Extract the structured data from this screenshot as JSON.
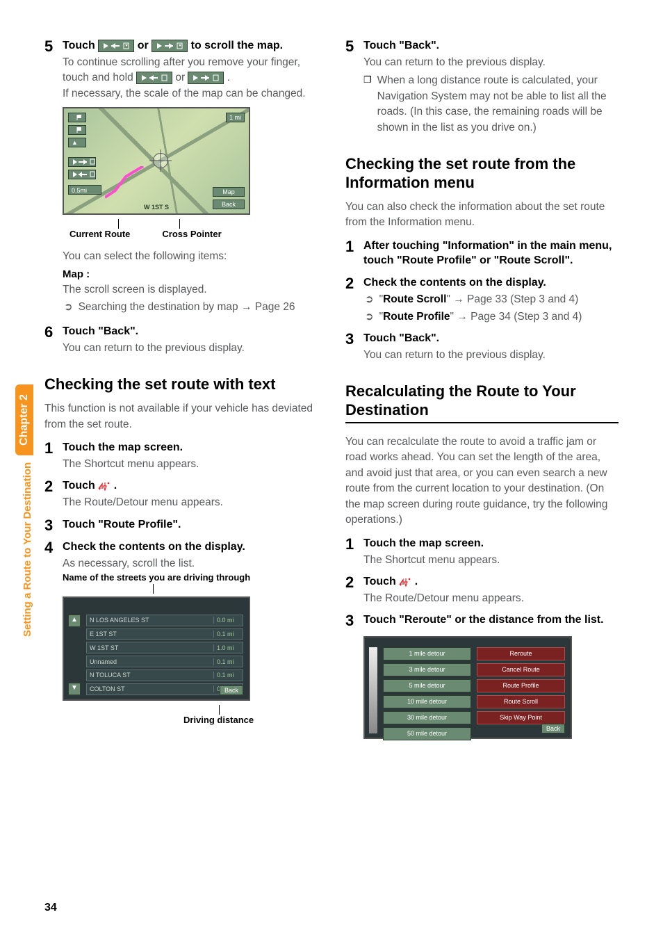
{
  "side": {
    "section": "Setting a Route to Your Destination",
    "chapter": "Chapter 2"
  },
  "page_number": "34",
  "left": {
    "step5": {
      "num": "5",
      "title_a": "Touch ",
      "title_b": " or ",
      "title_c": " to scroll the map.",
      "text_a": "To continue scrolling after you remove your finger, touch and hold ",
      "text_b": " or ",
      "text_c": ".",
      "text_d": "If necessary, the scale of the map can be changed.",
      "img_label_left": "Current Route",
      "img_label_right": "Cross Pointer",
      "text_e": "You can select the following items:",
      "map_label": "Map :",
      "map_text": "The scroll screen is displayed.",
      "sub_bullet": "Searching the destination by map ",
      "sub_bullet_ref": "Page 26",
      "map_ui": {
        "scale_btn": "1 mi",
        "map_btn": "Map",
        "back_btn": "Back",
        "dist_btn": "0.5mi",
        "street": "W 1ST S"
      }
    },
    "step6": {
      "num": "6",
      "title": "Touch \"Back\".",
      "text": "You can return to the previous display."
    },
    "h2a": "Checking the set route with text",
    "h2a_text": "This function is not available if your vehicle has deviated from the set route.",
    "text_step1": {
      "num": "1",
      "title": "Touch the map screen.",
      "text": "The Shortcut menu appears."
    },
    "text_step2": {
      "num": "2",
      "title_a": "Touch ",
      "title_b": ".",
      "text": "The Route/Detour menu appears."
    },
    "text_step3": {
      "num": "3",
      "title": "Touch \"Route Profile\"."
    },
    "text_step4": {
      "num": "4",
      "title": "Check the contents on the display.",
      "text": "As necessary, scroll the list."
    },
    "profile_caption_top": "Name of the streets you are driving through",
    "profile_rows": [
      {
        "name": "N LOS ANGELES ST",
        "dist": "0.0  mi"
      },
      {
        "name": "E 1ST ST",
        "dist": "0.1  mi"
      },
      {
        "name": "W 1ST ST",
        "dist": "1.0  mi"
      },
      {
        "name": "Unnamed",
        "dist": "0.1  mi"
      },
      {
        "name": "N TOLUCA ST",
        "dist": "0.1  mi"
      },
      {
        "name": "COLTON ST",
        "dist": "0.2  mi"
      }
    ],
    "profile_back": "Back",
    "profile_caption_bottom": "Driving distance"
  },
  "right": {
    "step5": {
      "num": "5",
      "title": "Touch \"Back\".",
      "text": "You can return to the previous display.",
      "note": "When a long distance route is calculated, your Navigation System may not be able to list all the roads. (In this case, the remaining roads will be shown in the list as you drive on.)"
    },
    "h2b": "Checking the set route from the Information menu",
    "h2b_text": "You can also check the information about the set route from the Information menu.",
    "info_step1": {
      "num": "1",
      "title": "After touching \"Information\" in the main menu, touch \"Route Profile\" or \"Route Scroll\"."
    },
    "info_step2": {
      "num": "2",
      "title": "Check the contents on the display.",
      "b1_label": "Route Scroll",
      "b1_ref": "Page 33 (Step 3 and 4)",
      "b2_label": "Route Profile",
      "b2_ref": "Page 34 (Step 3 and 4)"
    },
    "info_step3": {
      "num": "3",
      "title": "Touch \"Back\".",
      "text": "You can return to the previous display."
    },
    "h2c": "Recalculating the Route to Your Destination",
    "h2c_text": "You can recalculate the route to avoid a traffic jam or road works ahead. You can set the length of the area, and avoid just that area, or you can even search a new route from the current location to your destination. (On the map screen during route guidance, try the following operations.)",
    "recalc_step1": {
      "num": "1",
      "title": "Touch the map screen.",
      "text": "The Shortcut menu appears."
    },
    "recalc_step2": {
      "num": "2",
      "title_a": "Touch ",
      "title_b": ".",
      "text": "The Route/Detour menu appears."
    },
    "recalc_step3": {
      "num": "3",
      "title": "Touch \"Reroute\" or the distance from the list."
    },
    "reroute_left": [
      "1 mile detour",
      "3 mile detour",
      "5 mile detour",
      "10 mile detour",
      "30 mile detour",
      "50 mile detour"
    ],
    "reroute_right": [
      "Reroute",
      "Cancel Route",
      "Route Profile",
      "Route Scroll",
      "Skip Way Point"
    ],
    "reroute_back": "Back"
  }
}
